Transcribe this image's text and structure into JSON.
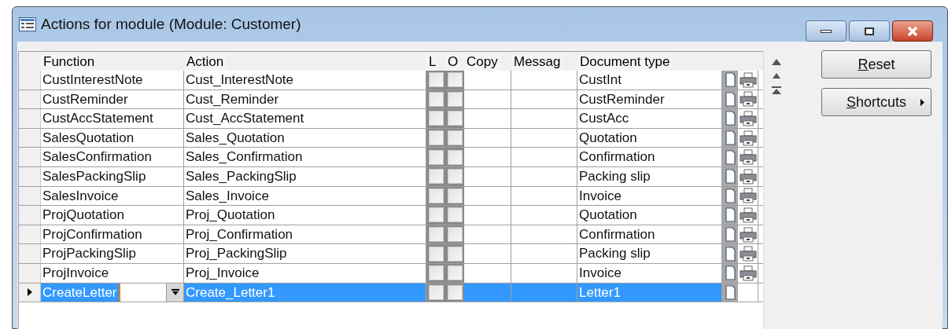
{
  "window": {
    "title": "Actions for module (Module: Customer)"
  },
  "table": {
    "columns": [
      "Function",
      "Action",
      "L",
      "O",
      "Copy",
      "Messag",
      "Document type"
    ],
    "rows": [
      {
        "function": "CustInterestNote",
        "action": "Cust_InterestNote",
        "l_checked": false,
        "o_checked": false,
        "document_type": "CustInt",
        "printer": true,
        "selected": false
      },
      {
        "function": "CustReminder",
        "action": "Cust_Reminder",
        "l_checked": false,
        "o_checked": false,
        "document_type": "CustReminder",
        "printer": true,
        "selected": false
      },
      {
        "function": "CustAccStatement",
        "action": "Cust_AccStatement",
        "l_checked": false,
        "o_checked": false,
        "document_type": "CustAcc",
        "printer": true,
        "selected": false
      },
      {
        "function": "SalesQuotation",
        "action": "Sales_Quotation",
        "l_checked": false,
        "o_checked": false,
        "document_type": "Quotation",
        "printer": true,
        "selected": false
      },
      {
        "function": "SalesConfirmation",
        "action": "Sales_Confirmation",
        "l_checked": false,
        "o_checked": false,
        "document_type": "Confirmation",
        "printer": true,
        "selected": false
      },
      {
        "function": "SalesPackingSlip",
        "action": "Sales_PackingSlip",
        "l_checked": false,
        "o_checked": false,
        "document_type": "Packing slip",
        "printer": true,
        "selected": false
      },
      {
        "function": "SalesInvoice",
        "action": "Sales_Invoice",
        "l_checked": false,
        "o_checked": false,
        "document_type": "Invoice",
        "printer": true,
        "selected": false
      },
      {
        "function": "ProjQuotation",
        "action": "Proj_Quotation",
        "l_checked": false,
        "o_checked": false,
        "document_type": "Quotation",
        "printer": true,
        "selected": false
      },
      {
        "function": "ProjConfirmation",
        "action": "Proj_Confirmation",
        "l_checked": false,
        "o_checked": false,
        "document_type": "Confirmation",
        "printer": true,
        "selected": false
      },
      {
        "function": "ProjPackingSlip",
        "action": "Proj_PackingSlip",
        "l_checked": false,
        "o_checked": false,
        "document_type": "Packing slip",
        "printer": true,
        "selected": false
      },
      {
        "function": "ProjInvoice",
        "action": "Proj_Invoice",
        "l_checked": false,
        "o_checked": false,
        "document_type": "Invoice",
        "printer": true,
        "selected": false
      },
      {
        "function": "CreateLetter",
        "action": "Create_Letter1",
        "l_checked": false,
        "o_checked": false,
        "document_type": "Letter1",
        "printer": false,
        "selected": true
      }
    ]
  },
  "buttons": [
    {
      "label": "Reset",
      "has_submenu": false
    },
    {
      "label": "Shortcuts",
      "has_submenu": true
    }
  ]
}
